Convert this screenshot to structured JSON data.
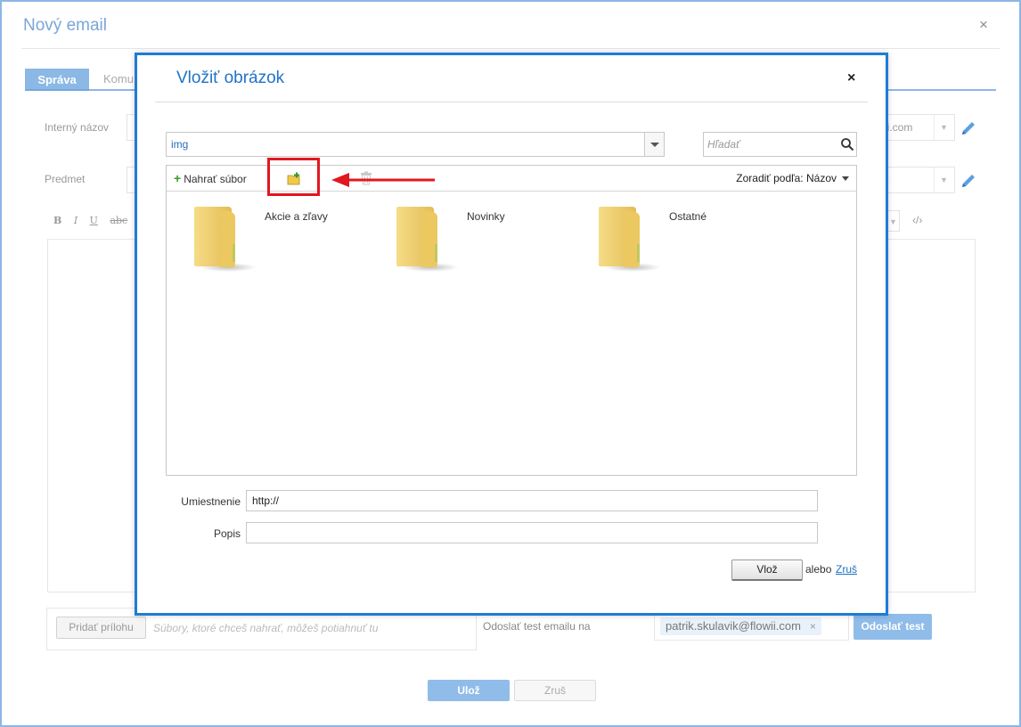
{
  "outer": {
    "title": "Nový email",
    "close_symbol": "×",
    "tabs": {
      "active": "Správa",
      "other": "Komu"
    },
    "fields": {
      "internal_name_label": "Interný názov",
      "subject_label": "Predmet",
      "sender_fragment": "ii.com"
    },
    "editor_tools": [
      "B",
      "I",
      "U",
      "abc"
    ],
    "code_symbol": "‹/›",
    "attach_button": "Pridať prílohu",
    "attach_hint": "Súbory, ktoré chceš nahrať, môžeš potiahnuť tu",
    "test_label": "Odoslať test emailu na",
    "test_chip": "patrik.skulavik@flowii.com",
    "test_chip_remove": "×",
    "test_button": "Odoslať test",
    "save_button": "Ulož",
    "cancel_button": "Zruš"
  },
  "modal": {
    "title": "Vložiť obrázok",
    "close_symbol": "×",
    "folder_path": "img",
    "search_placeholder": "Hľadať",
    "toolbar": {
      "upload_plus": "+",
      "upload_label": "Nahrať súbor",
      "sort_label": "Zoradiť podľa: Názov"
    },
    "folders": [
      {
        "name": "Akcie a zľavy"
      },
      {
        "name": "Novinky"
      },
      {
        "name": "Ostatné"
      }
    ],
    "location_label": "Umiestnenie",
    "location_value": "http://",
    "description_label": "Popis",
    "description_value": "",
    "insert_button": "Vlož",
    "or_text": "alebo",
    "cancel_link": "Zruš"
  },
  "colors": {
    "modal_border": "#1f7bd4",
    "highlight": "#e0181f",
    "link": "#1f6fc4"
  }
}
